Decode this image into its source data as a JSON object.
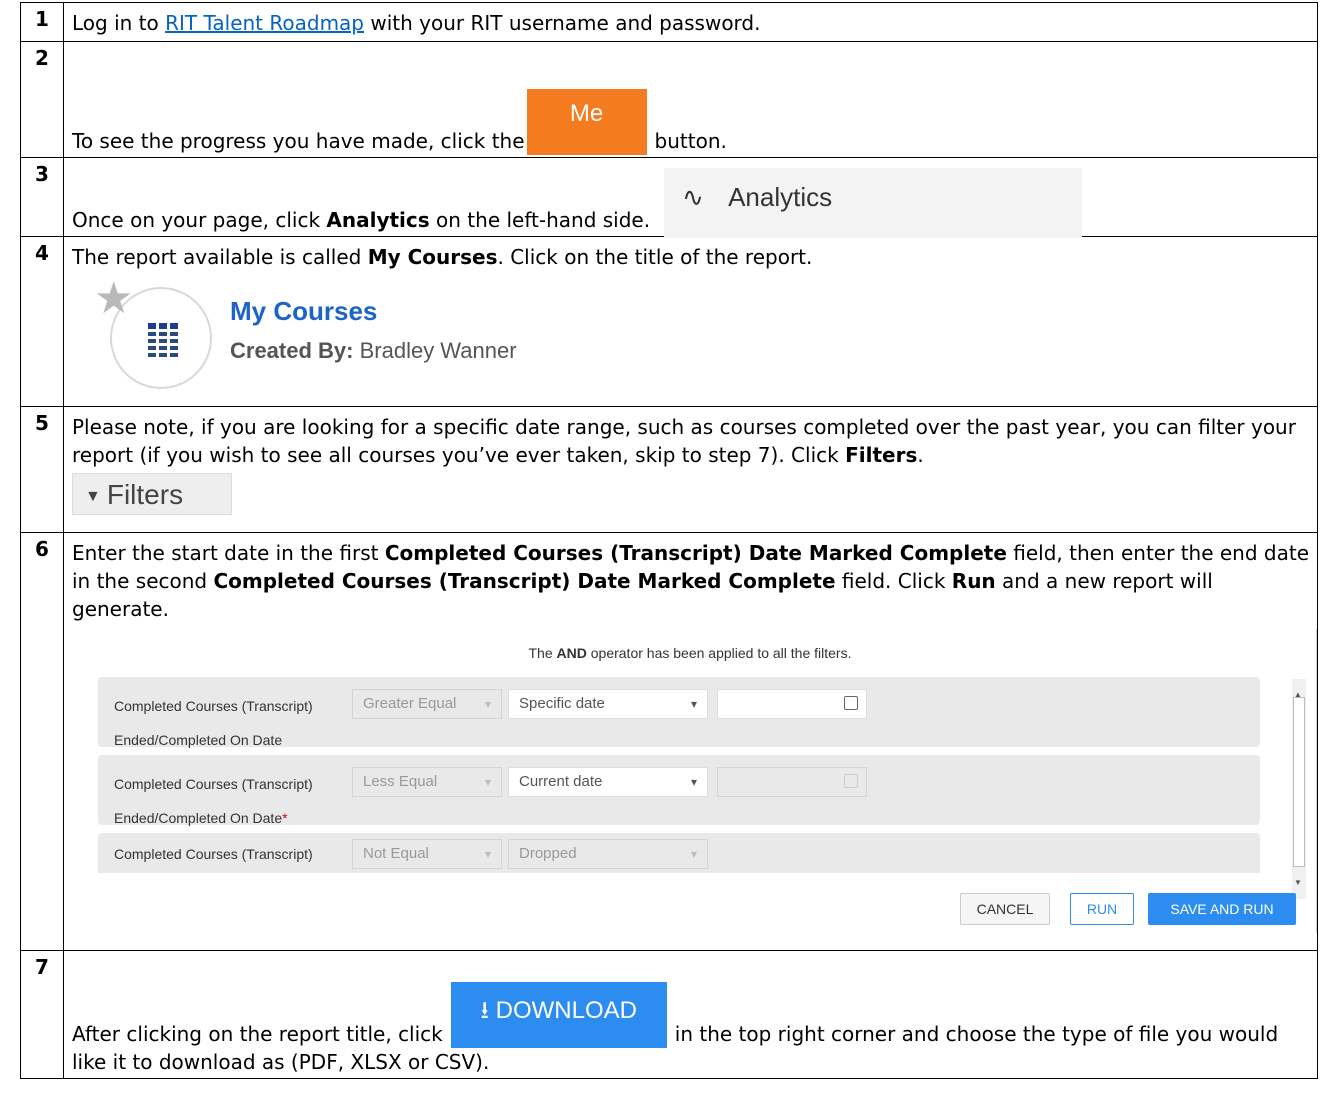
{
  "steps": {
    "s1": {
      "num": "1",
      "pre": "Log in to ",
      "link": "RIT Talent Roadmap",
      "post": " with your RIT username and password."
    },
    "s2": {
      "num": "2",
      "pre": "To see the progress you have made, click the",
      "button": "Me",
      "post": "button."
    },
    "s3": {
      "num": "3",
      "pre": "Once on your page, click ",
      "bold": "Analytics",
      "post": " on the left-hand side.",
      "image_label": "Analytics",
      "image_icon": "analytics-icon"
    },
    "s4": {
      "num": "4",
      "pre": "The report available is called ",
      "bold": "My Courses",
      "post": ". Click on the title of the report.",
      "report_title": "My Courses",
      "report_by_label": "Created By:",
      "report_by_name": " Bradley Wanner"
    },
    "s5": {
      "num": "5",
      "text": "Please note, if you are looking for a specific date range, such as courses completed over the past year, you can filter your report (if you wish to see all courses you’ve ever taken, skip to step 7). Click ",
      "bold": "Filters",
      "post": ".",
      "filters_label": "Filters"
    },
    "s6": {
      "num": "6",
      "t1": "Enter the start date in the first ",
      "b1": "Completed Courses (Transcript) Date Marked Complete",
      "t2": " field, then enter the end date in the second ",
      "b2": "Completed Courses (Transcript) Date Marked Complete",
      "t3": " field. Click ",
      "b3": "Run",
      "t4": " and a new report will generate."
    },
    "s7": {
      "num": "7",
      "pre": "After clicking on the report title, click",
      "button": "DOWNLOAD",
      "post": "in the top right corner and choose the type of file you would like it to download as (PDF, XLSX or CSV)."
    }
  },
  "filter_panel": {
    "note_pre": "The ",
    "note_bold": "AND",
    "note_post": " operator has been applied to all the filters.",
    "rows": [
      {
        "name1": "Completed Courses (Transcript)",
        "name2": "Ended/Completed On Date",
        "required": "",
        "operator": "Greater Equal",
        "mode": "Specific date",
        "date": ""
      },
      {
        "name1": "Completed Courses (Transcript)",
        "name2": "Ended/Completed On Date",
        "required": "*",
        "operator": "Less Equal",
        "mode": "Current date",
        "date": ""
      },
      {
        "name1": "Completed Courses (Transcript)",
        "operator": "Not Equal",
        "mode": "Dropped"
      }
    ],
    "buttons": {
      "cancel": "CANCEL",
      "run": "RUN",
      "save_and_run": "SAVE AND RUN"
    }
  }
}
